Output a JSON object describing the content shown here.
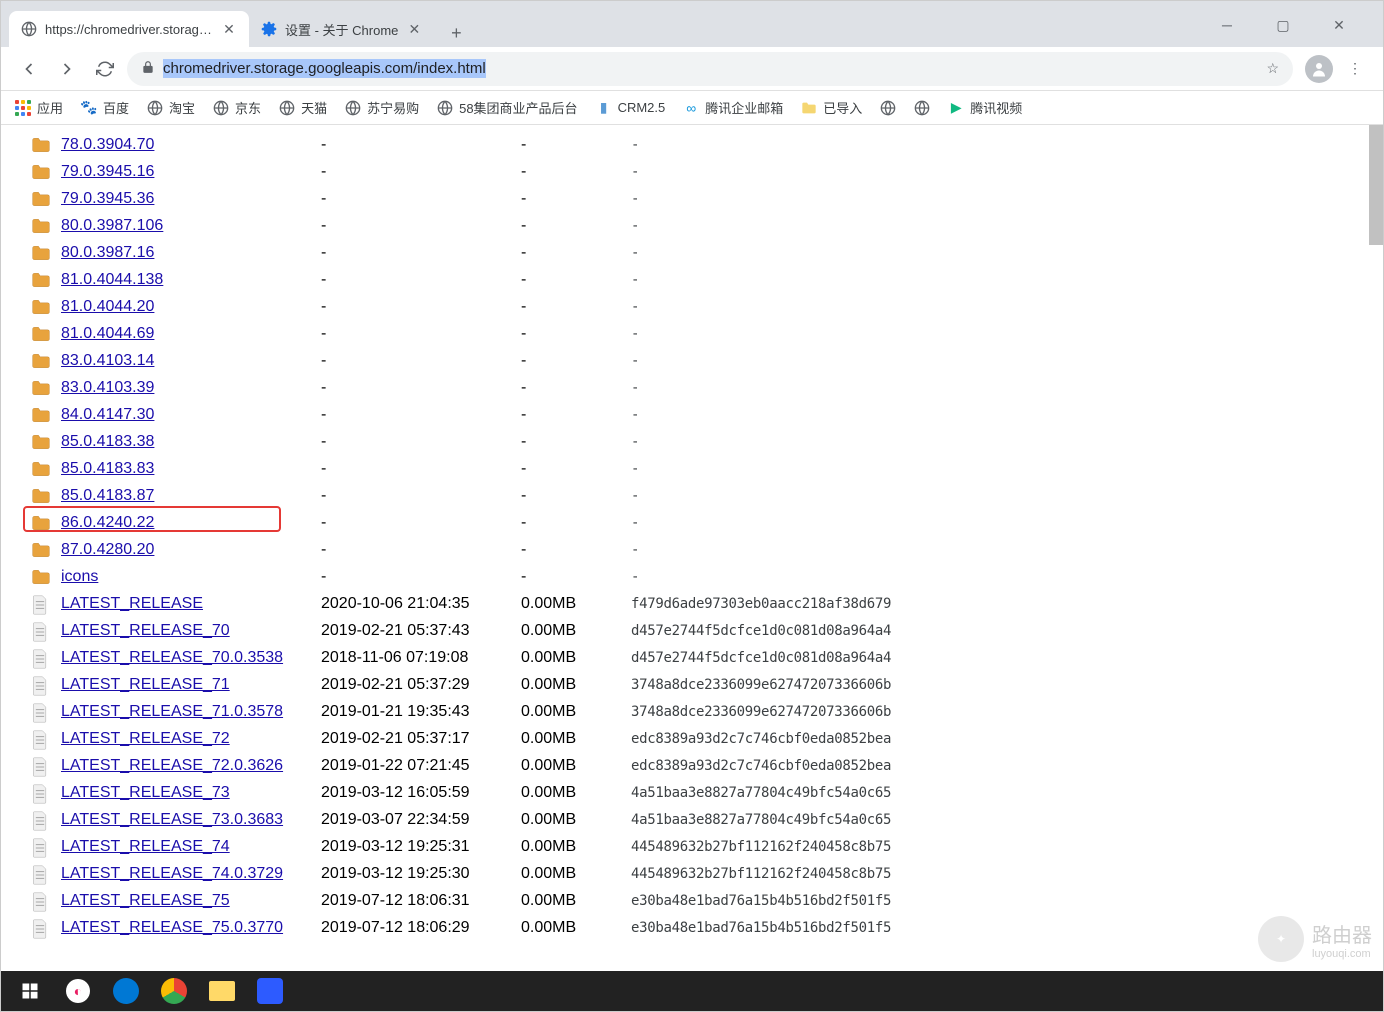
{
  "window": {
    "tabs": [
      {
        "title": "https://chromedriver.storage.c",
        "active": true,
        "icon": "globe"
      },
      {
        "title": "设置 - 关于 Chrome",
        "active": false,
        "icon": "gear"
      }
    ],
    "url": "chromedriver.storage.googleapis.com/index.html"
  },
  "bookmarks": [
    {
      "label": "应用",
      "icon": "apps"
    },
    {
      "label": "百度",
      "icon": "paw",
      "color": "#4e6ef2"
    },
    {
      "label": "淘宝",
      "icon": "globe"
    },
    {
      "label": "京东",
      "icon": "globe"
    },
    {
      "label": "天猫",
      "icon": "globe"
    },
    {
      "label": "苏宁易购",
      "icon": "globe"
    },
    {
      "label": "58集团商业产品后台",
      "icon": "globe"
    },
    {
      "label": "CRM2.5",
      "icon": "doc",
      "color": "#5b9bd5"
    },
    {
      "label": "腾讯企业邮箱",
      "icon": "infinity",
      "color": "#1296db"
    },
    {
      "label": "已导入",
      "icon": "folder",
      "color": "#f5d671"
    },
    {
      "label": "",
      "icon": "globe"
    },
    {
      "label": "",
      "icon": "globe"
    },
    {
      "label": "腾讯视频",
      "icon": "play",
      "color": "#10b981"
    }
  ],
  "listing": [
    {
      "type": "folder",
      "name": "78.0.3904.70",
      "date": "-",
      "size": "-",
      "hash": "-"
    },
    {
      "type": "folder",
      "name": "79.0.3945.16",
      "date": "-",
      "size": "-",
      "hash": "-"
    },
    {
      "type": "folder",
      "name": "79.0.3945.36",
      "date": "-",
      "size": "-",
      "hash": "-"
    },
    {
      "type": "folder",
      "name": "80.0.3987.106",
      "date": "-",
      "size": "-",
      "hash": "-"
    },
    {
      "type": "folder",
      "name": "80.0.3987.16",
      "date": "-",
      "size": "-",
      "hash": "-"
    },
    {
      "type": "folder",
      "name": "81.0.4044.138",
      "date": "-",
      "size": "-",
      "hash": "-"
    },
    {
      "type": "folder",
      "name": "81.0.4044.20",
      "date": "-",
      "size": "-",
      "hash": "-"
    },
    {
      "type": "folder",
      "name": "81.0.4044.69",
      "date": "-",
      "size": "-",
      "hash": "-"
    },
    {
      "type": "folder",
      "name": "83.0.4103.14",
      "date": "-",
      "size": "-",
      "hash": "-"
    },
    {
      "type": "folder",
      "name": "83.0.4103.39",
      "date": "-",
      "size": "-",
      "hash": "-"
    },
    {
      "type": "folder",
      "name": "84.0.4147.30",
      "date": "-",
      "size": "-",
      "hash": "-"
    },
    {
      "type": "folder",
      "name": "85.0.4183.38",
      "date": "-",
      "size": "-",
      "hash": "-"
    },
    {
      "type": "folder",
      "name": "85.0.4183.83",
      "date": "-",
      "size": "-",
      "hash": "-"
    },
    {
      "type": "folder",
      "name": "85.0.4183.87",
      "date": "-",
      "size": "-",
      "hash": "-"
    },
    {
      "type": "folder",
      "name": "86.0.4240.22",
      "date": "-",
      "size": "-",
      "hash": "-",
      "highlighted": true
    },
    {
      "type": "folder",
      "name": "87.0.4280.20",
      "date": "-",
      "size": "-",
      "hash": "-"
    },
    {
      "type": "folder",
      "name": "icons",
      "date": "-",
      "size": "-",
      "hash": "-"
    },
    {
      "type": "file",
      "name": "LATEST_RELEASE",
      "date": "2020-10-06 21:04:35",
      "size": "0.00MB",
      "hash": "f479d6ade97303eb0aacc218af38d679"
    },
    {
      "type": "file",
      "name": "LATEST_RELEASE_70",
      "date": "2019-02-21 05:37:43",
      "size": "0.00MB",
      "hash": "d457e2744f5dcfce1d0c081d08a964a4"
    },
    {
      "type": "file",
      "name": "LATEST_RELEASE_70.0.3538",
      "date": "2018-11-06 07:19:08",
      "size": "0.00MB",
      "hash": "d457e2744f5dcfce1d0c081d08a964a4"
    },
    {
      "type": "file",
      "name": "LATEST_RELEASE_71",
      "date": "2019-02-21 05:37:29",
      "size": "0.00MB",
      "hash": "3748a8dce2336099e62747207336606b"
    },
    {
      "type": "file",
      "name": "LATEST_RELEASE_71.0.3578",
      "date": "2019-01-21 19:35:43",
      "size": "0.00MB",
      "hash": "3748a8dce2336099e62747207336606b"
    },
    {
      "type": "file",
      "name": "LATEST_RELEASE_72",
      "date": "2019-02-21 05:37:17",
      "size": "0.00MB",
      "hash": "edc8389a93d2c7c746cbf0eda0852bea"
    },
    {
      "type": "file",
      "name": "LATEST_RELEASE_72.0.3626",
      "date": "2019-01-22 07:21:45",
      "size": "0.00MB",
      "hash": "edc8389a93d2c7c746cbf0eda0852bea"
    },
    {
      "type": "file",
      "name": "LATEST_RELEASE_73",
      "date": "2019-03-12 16:05:59",
      "size": "0.00MB",
      "hash": "4a51baa3e8827a77804c49bfc54a0c65"
    },
    {
      "type": "file",
      "name": "LATEST_RELEASE_73.0.3683",
      "date": "2019-03-07 22:34:59",
      "size": "0.00MB",
      "hash": "4a51baa3e8827a77804c49bfc54a0c65"
    },
    {
      "type": "file",
      "name": "LATEST_RELEASE_74",
      "date": "2019-03-12 19:25:31",
      "size": "0.00MB",
      "hash": "445489632b27bf112162f240458c8b75"
    },
    {
      "type": "file",
      "name": "LATEST_RELEASE_74.0.3729",
      "date": "2019-03-12 19:25:30",
      "size": "0.00MB",
      "hash": "445489632b27bf112162f240458c8b75"
    },
    {
      "type": "file",
      "name": "LATEST_RELEASE_75",
      "date": "2019-07-12 18:06:31",
      "size": "0.00MB",
      "hash": "e30ba48e1bad76a15b4b516bd2f501f5"
    },
    {
      "type": "file",
      "name": "LATEST_RELEASE_75.0.3770",
      "date": "2019-07-12 18:06:29",
      "size": "0.00MB",
      "hash": "e30ba48e1bad76a15b4b516bd2f501f5"
    }
  ],
  "watermark": {
    "text": "路由器",
    "sub": "luyouqi.com"
  }
}
